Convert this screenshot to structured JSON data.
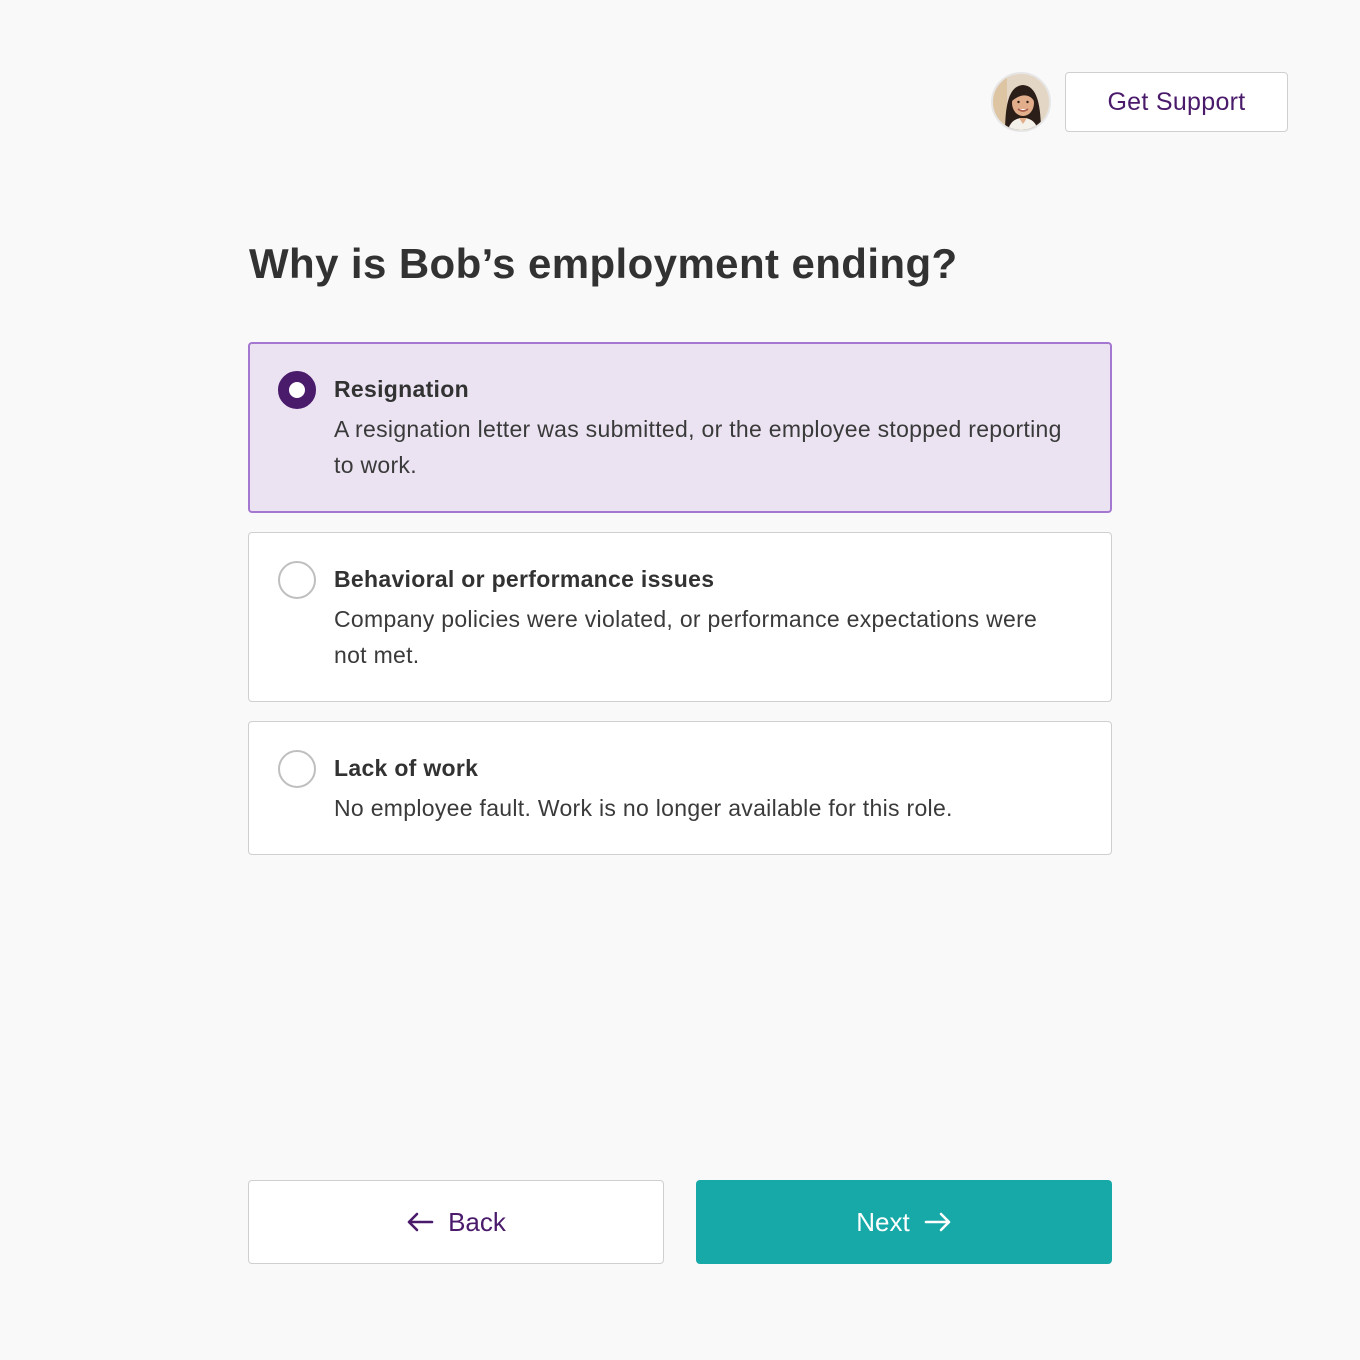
{
  "header": {
    "avatar_icon": "support-agent-avatar",
    "support_label": "Get Support"
  },
  "question": {
    "title": "Why is Bob’s employment ending?"
  },
  "options": [
    {
      "title": "Resignation",
      "description": "A resignation letter was submitted, or the employee stopped reporting to work.",
      "selected": true
    },
    {
      "title": "Behavioral or performance issues",
      "description": "Company policies were violated, or performance expectations were not met.",
      "selected": false
    },
    {
      "title": "Lack of work",
      "description": "No employee fault. Work is no longer available for this role.",
      "selected": false
    }
  ],
  "footer": {
    "back_label": "Back",
    "next_label": "Next"
  },
  "colors": {
    "brand_purple": "#4a1a6b",
    "selected_bg": "#ebe3f2",
    "selected_border": "#a478d0",
    "primary_teal": "#17a9a8"
  }
}
